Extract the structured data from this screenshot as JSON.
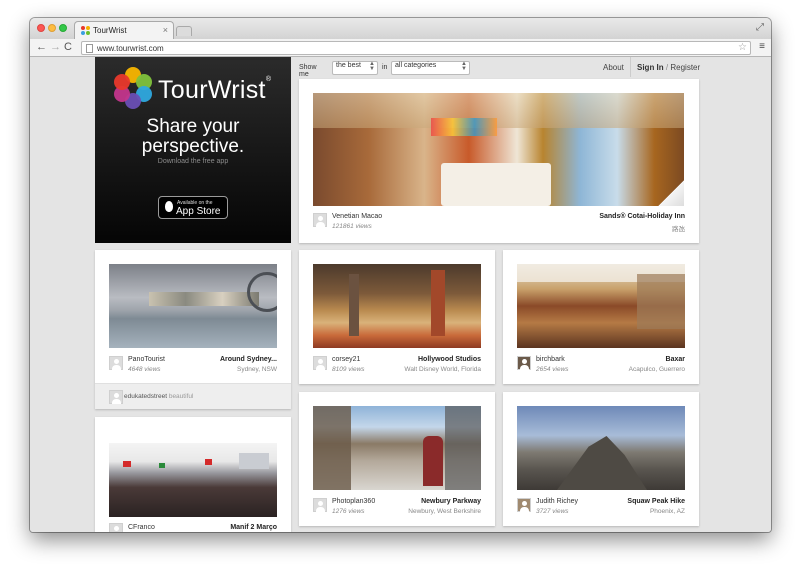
{
  "browser": {
    "tab_title": "TourWrist",
    "tab_close": "×",
    "url": "www.tourwrist.com",
    "nav": {
      "back": "←",
      "forward": "→",
      "reload": "C"
    },
    "star": "☆",
    "menu": "≡"
  },
  "promo": {
    "logo_text": "TourWrist",
    "logo_reg": "®",
    "tagline_line1": "Share your",
    "tagline_line2": "perspective.",
    "subtext": "Download the free app",
    "appstore_small": "Available on the",
    "appstore_main": "App Store"
  },
  "filter": {
    "show_me_label": "Show me",
    "sort_value": "the best",
    "in_label": "in",
    "category_value": "all categories"
  },
  "nav": {
    "about": "About",
    "sign_in": "Sign In",
    "divider": "/",
    "register": "Register"
  },
  "cards": [
    {
      "user": "Venetian Macao",
      "views": "121861 views",
      "title": "Sands® Cotai-Holiday Inn",
      "location": "路氹"
    },
    {
      "user": "PanoTourist",
      "views": "4648 views",
      "title": "Around Sydney...",
      "location": "Sydney, NSW"
    },
    {
      "user": "corsey21",
      "views": "8109 views",
      "title": "Hollywood Studios",
      "location": "Walt Disney World, Florida"
    },
    {
      "user": "birchbark",
      "views": "2654 views",
      "title": "Baxar",
      "location": "Acapulco, Guerrero"
    },
    {
      "user": "CFranco",
      "views": "",
      "title": "Manif 2 Março",
      "location": ""
    },
    {
      "user": "Photoplan360",
      "views": "1276 views",
      "title": "Newbury Parkway",
      "location": "Newbury, West Berkshire"
    },
    {
      "user": "Judith Richey",
      "views": "3727 views",
      "title": "Squaw Peak Hike",
      "location": "Phoenix, AZ"
    }
  ],
  "comment": {
    "user": "edukatedstreet",
    "text": "beautiful"
  },
  "colors": {
    "accent": "#fc5753",
    "page_bg": "#e4e4e4"
  }
}
